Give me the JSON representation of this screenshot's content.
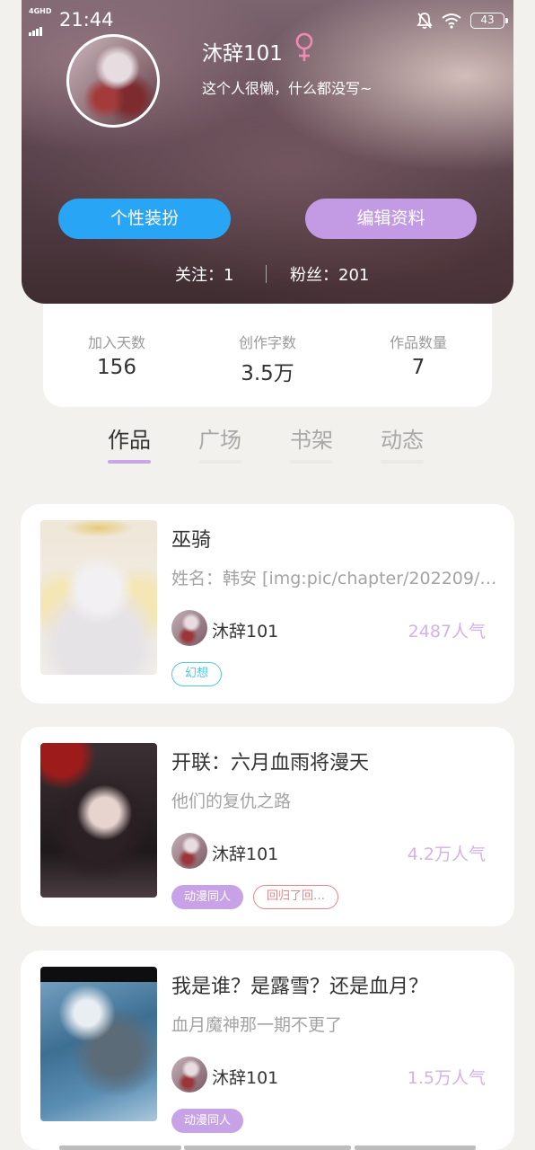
{
  "status_bar": {
    "network": "4GHD",
    "time": "21:44",
    "battery": "43"
  },
  "profile": {
    "username": "沐辞101",
    "gender_symbol": "♀",
    "bio": "这个人很懒，什么都没写~",
    "decorate_label": "个性装扮",
    "edit_label": "编辑资料",
    "following": "关注：1",
    "fans": "粉丝：201"
  },
  "stats": [
    {
      "label": "加入天数",
      "value": "156"
    },
    {
      "label": "创作字数",
      "value": "3.5万"
    },
    {
      "label": "作品数量",
      "value": "7"
    }
  ],
  "tabs": [
    {
      "label": "作品",
      "active": true
    },
    {
      "label": "广场",
      "active": false
    },
    {
      "label": "书架",
      "active": false
    },
    {
      "label": "动态",
      "active": false
    }
  ],
  "works": [
    {
      "title": "巫骑",
      "desc": "姓名：韩安 [img:pic/chapter/202209/…",
      "author": "沐辞101",
      "popularity": "2487人气",
      "tags": [
        {
          "label": "幻想",
          "style": "outline-cyan"
        }
      ]
    },
    {
      "title": "开联：六月血雨将漫天",
      "desc": "他们的复仇之路",
      "author": "沐辞101",
      "popularity": "4.2万人气",
      "tags": [
        {
          "label": "动漫同人",
          "style": "filled-purple"
        },
        {
          "label": "回归了回…",
          "style": "outline-red"
        }
      ]
    },
    {
      "title": "我是谁？是露雪？还是血月？",
      "desc": "血月魔神那一期不更了",
      "author": "沐辞101",
      "popularity": "1.5万人气",
      "tags": [
        {
          "label": "动漫同人",
          "style": "filled-purple"
        }
      ]
    }
  ],
  "colors": {
    "accent_purple": "#c39be4",
    "accent_blue": "#29a5f5",
    "popularity": "#d3b2ea",
    "gender": "#f08ab4"
  }
}
